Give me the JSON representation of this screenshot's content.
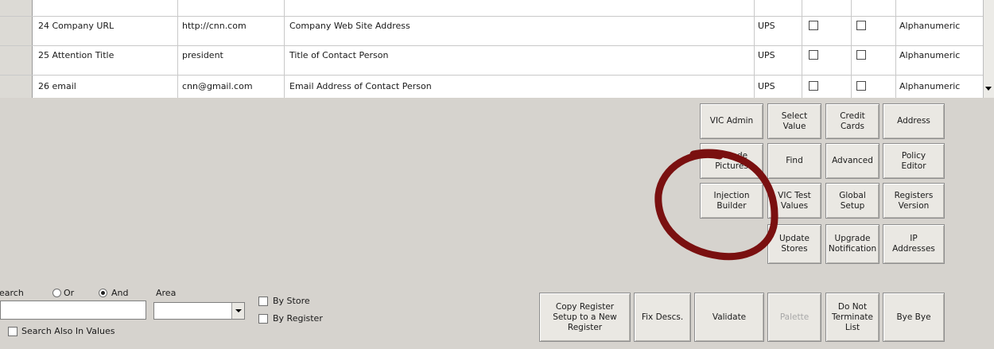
{
  "grid": {
    "rows": [
      {
        "name": "24 Company URL",
        "value": "http://cnn.com",
        "description": "Company Web Site Address",
        "source": "UPS",
        "type": "Alphanumeric"
      },
      {
        "name": "25 Attention Title",
        "value": "president",
        "description": "Title of Contact Person",
        "source": "UPS",
        "type": "Alphanumeric"
      },
      {
        "name": "26 email",
        "value": "cnn@gmail.com",
        "description": "Email Address of Contact Person",
        "source": "UPS",
        "type": "Alphanumeric"
      }
    ]
  },
  "buttons": {
    "vic_admin": "VIC Admin",
    "select_value": "Select\nValue",
    "credit_cards": "Credit\nCards",
    "address": "Address",
    "v_mode": "V mode\nPictures",
    "find": "Find",
    "advanced": "Advanced",
    "policy_editor": "Policy\nEditor",
    "injection_builder": "Injection\nBuilder",
    "vic_test_values": "VIC Test\nValues",
    "global_setup": "Global\nSetup",
    "registers_version": "Registers\nVersion",
    "update_stores": "Update\nStores",
    "upgrade_notification": "Upgrade\nNotification",
    "ip_addresses": "IP\nAddresses",
    "copy_register": "Copy Register\nSetup to a New\nRegister",
    "fix_descs": "Fix Descs.",
    "validate": "Validate",
    "palette": "Palette",
    "do_not_terminate": "Do Not\nTerminate\nList",
    "bye_bye": "Bye Bye"
  },
  "search": {
    "label": "Search",
    "or_label": "Or",
    "and_label": "And",
    "area_label": "Area",
    "by_store": "By Store",
    "by_register": "By Register",
    "also_in_values": "Search Also In Values"
  },
  "annotation": {
    "color": "#7a1010"
  }
}
